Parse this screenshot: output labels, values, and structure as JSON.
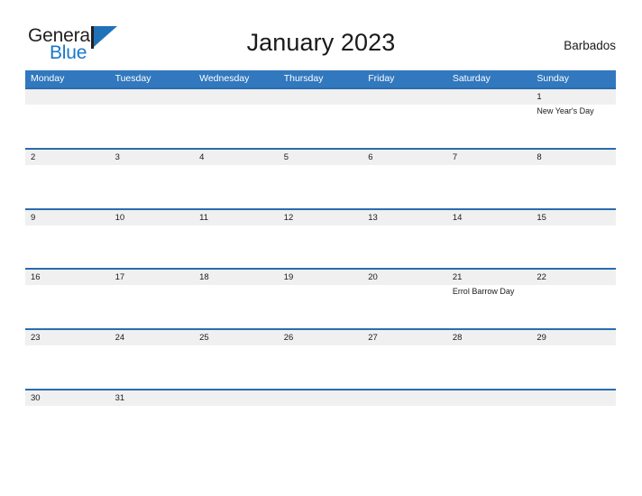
{
  "brand": {
    "word_one": "General",
    "word_two": "Blue",
    "flag_icon": "general-blue-flag-icon",
    "dark_color": "#231f20",
    "blue_color": "#1878c8"
  },
  "header": {
    "title": "January 2023",
    "country": "Barbados"
  },
  "theme": {
    "header_blue": "#3178be",
    "separator_blue": "#2b6cad",
    "band_gray": "#f0f0f0",
    "text": "#1a1a1a"
  },
  "calendar": {
    "weekdays": [
      "Monday",
      "Tuesday",
      "Wednesday",
      "Thursday",
      "Friday",
      "Saturday",
      "Sunday"
    ],
    "weeks": [
      [
        {
          "day": "",
          "events": []
        },
        {
          "day": "",
          "events": []
        },
        {
          "day": "",
          "events": []
        },
        {
          "day": "",
          "events": []
        },
        {
          "day": "",
          "events": []
        },
        {
          "day": "",
          "events": []
        },
        {
          "day": "1",
          "events": [
            "New Year's Day"
          ]
        }
      ],
      [
        {
          "day": "2",
          "events": []
        },
        {
          "day": "3",
          "events": []
        },
        {
          "day": "4",
          "events": []
        },
        {
          "day": "5",
          "events": []
        },
        {
          "day": "6",
          "events": []
        },
        {
          "day": "7",
          "events": []
        },
        {
          "day": "8",
          "events": []
        }
      ],
      [
        {
          "day": "9",
          "events": []
        },
        {
          "day": "10",
          "events": []
        },
        {
          "day": "11",
          "events": []
        },
        {
          "day": "12",
          "events": []
        },
        {
          "day": "13",
          "events": []
        },
        {
          "day": "14",
          "events": []
        },
        {
          "day": "15",
          "events": []
        }
      ],
      [
        {
          "day": "16",
          "events": []
        },
        {
          "day": "17",
          "events": []
        },
        {
          "day": "18",
          "events": []
        },
        {
          "day": "19",
          "events": []
        },
        {
          "day": "20",
          "events": []
        },
        {
          "day": "21",
          "events": [
            "Errol Barrow Day"
          ]
        },
        {
          "day": "22",
          "events": []
        }
      ],
      [
        {
          "day": "23",
          "events": []
        },
        {
          "day": "24",
          "events": []
        },
        {
          "day": "25",
          "events": []
        },
        {
          "day": "26",
          "events": []
        },
        {
          "day": "27",
          "events": []
        },
        {
          "day": "28",
          "events": []
        },
        {
          "day": "29",
          "events": []
        }
      ],
      [
        {
          "day": "30",
          "events": []
        },
        {
          "day": "31",
          "events": []
        },
        {
          "day": "",
          "events": []
        },
        {
          "day": "",
          "events": []
        },
        {
          "day": "",
          "events": []
        },
        {
          "day": "",
          "events": []
        },
        {
          "day": "",
          "events": []
        }
      ]
    ]
  }
}
